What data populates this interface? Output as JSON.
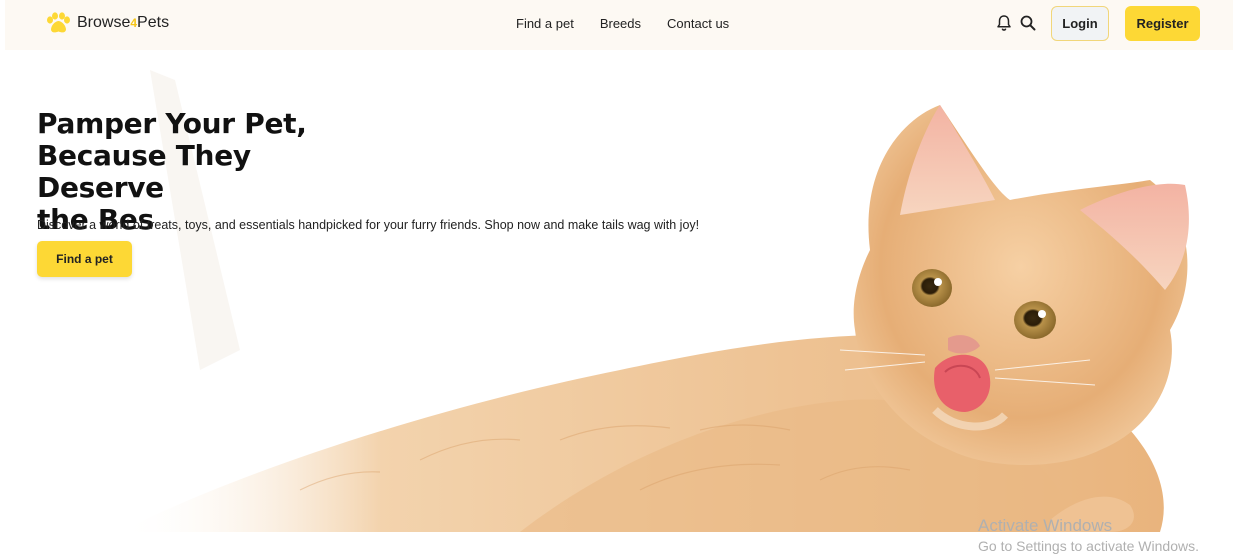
{
  "brand": {
    "logo_icon": "paw-icon",
    "name_part1": "Browse",
    "name_part2": "4",
    "name_part3": "Pets",
    "accent_color": "#fdd835"
  },
  "nav": {
    "links": [
      {
        "label": "Find a pet"
      },
      {
        "label": "Breeds"
      },
      {
        "label": "Contact us"
      }
    ],
    "icons": [
      "bell-icon",
      "search-icon"
    ],
    "login_label": "Login",
    "register_label": "Register"
  },
  "hero": {
    "title_line1": "Pamper Your Pet,",
    "title_line2": "Because They Deserve",
    "title_line3": "the Bes",
    "description": "Discover a world of treats, toys, and essentials handpicked for your furry friends. Shop now and make tails wag with joy!",
    "cta_label": "Find a pet",
    "image_subject": "orange-kitten-licking-lips"
  },
  "os_watermark": {
    "title": "Activate Windows",
    "subtitle": "Go to Settings to activate Windows."
  }
}
